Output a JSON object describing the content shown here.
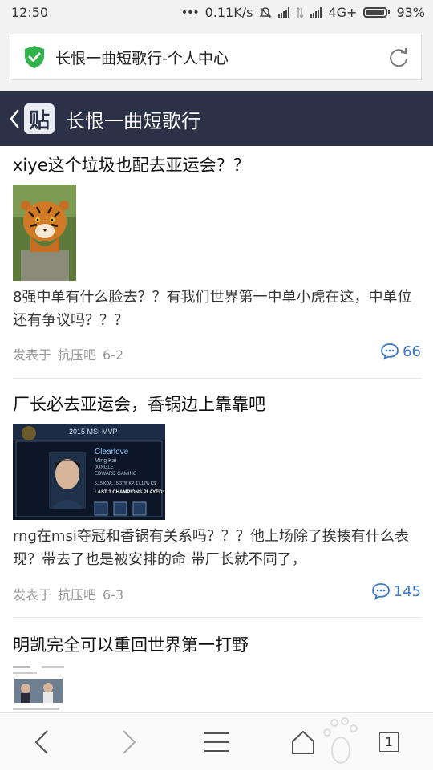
{
  "status_bar": {
    "time": "12:50",
    "dots": "•••",
    "speed": "0.11K/s",
    "network": "4G+",
    "battery": "93%",
    "battery_level": 0.93
  },
  "browser": {
    "url_title": "长恨一曲短歌行-个人中心"
  },
  "header": {
    "logo_text": "贴",
    "title": "长恨一曲短歌行"
  },
  "posts": [
    {
      "title": "xiye这个垃圾也配去亚运会？？",
      "body": "8强中单有什么脸去？？有我们世界第一中单小虎在这，中单位还有争议吗？？？",
      "meta_prefix": "发表于",
      "forum": "抗压吧",
      "date": "6-2",
      "comments": "66"
    },
    {
      "title": "厂长必去亚运会，香锅边上靠靠吧",
      "image_header": "2015 MSI MVP",
      "image_player": "Clearlove",
      "image_sub": "Ming Kai",
      "image_role": "JUNGLE",
      "image_team": "EDWARD GAMING",
      "image_stats": "5.15 KDA, 15.37% KP, 17.17% KS",
      "image_caption": "LAST 3 CHAMPIONS PLAYED:",
      "body": "rng在msi夺冠和香锅有关系吗？？？他上场除了挨揍有什么表现？带去了也是被安排的命 带厂长就不同了，",
      "meta_prefix": "发表于",
      "forum": "抗压吧",
      "date": "6-3",
      "comments": "145"
    },
    {
      "title": "明凯完全可以重回世界第一打野"
    }
  ],
  "bottom_nav": {
    "tab_count": "1"
  },
  "colors": {
    "header_bg": "#2b3146",
    "accent_blue": "#3a77c6",
    "shield_green": "#2fb34a"
  }
}
